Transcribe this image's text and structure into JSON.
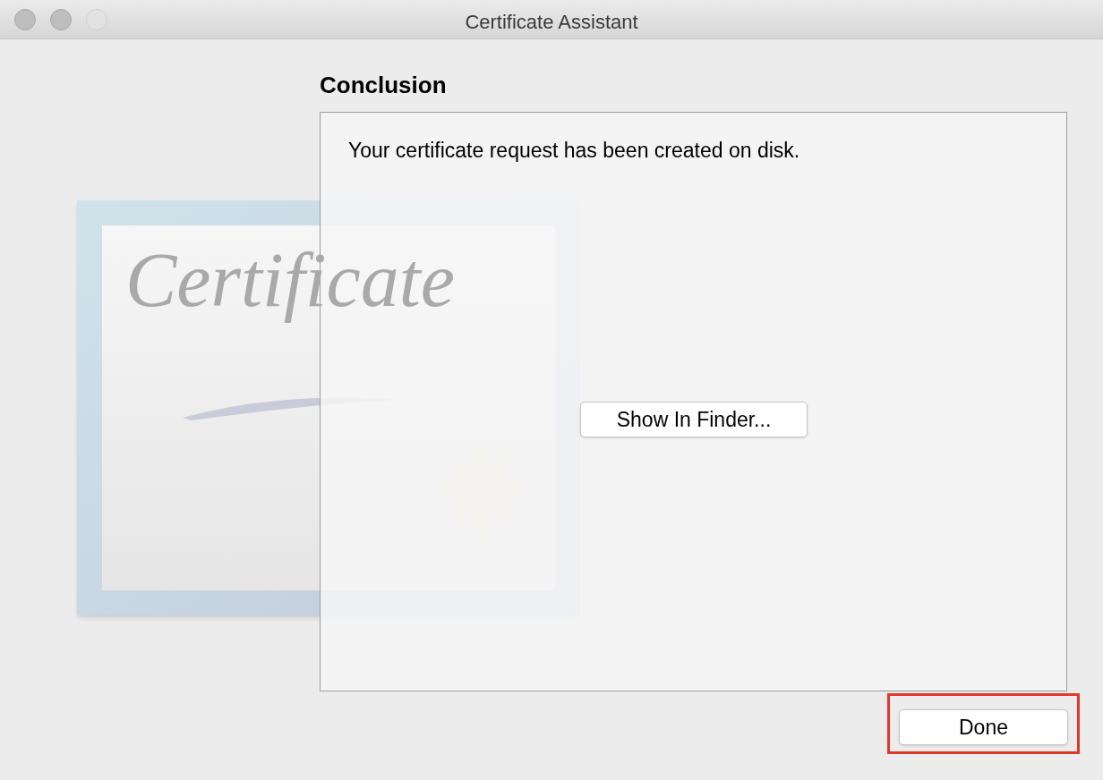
{
  "window": {
    "title": "Certificate Assistant",
    "controls": [
      {
        "disabled": false
      },
      {
        "disabled": false
      },
      {
        "disabled": true
      }
    ]
  },
  "artwork": {
    "caption": "Certificate"
  },
  "heading": "Conclusion",
  "panel": {
    "message": "Your certificate request has been created on disk.",
    "button": "Show In Finder..."
  },
  "footer": {
    "button": "Done",
    "highlighted": true
  }
}
